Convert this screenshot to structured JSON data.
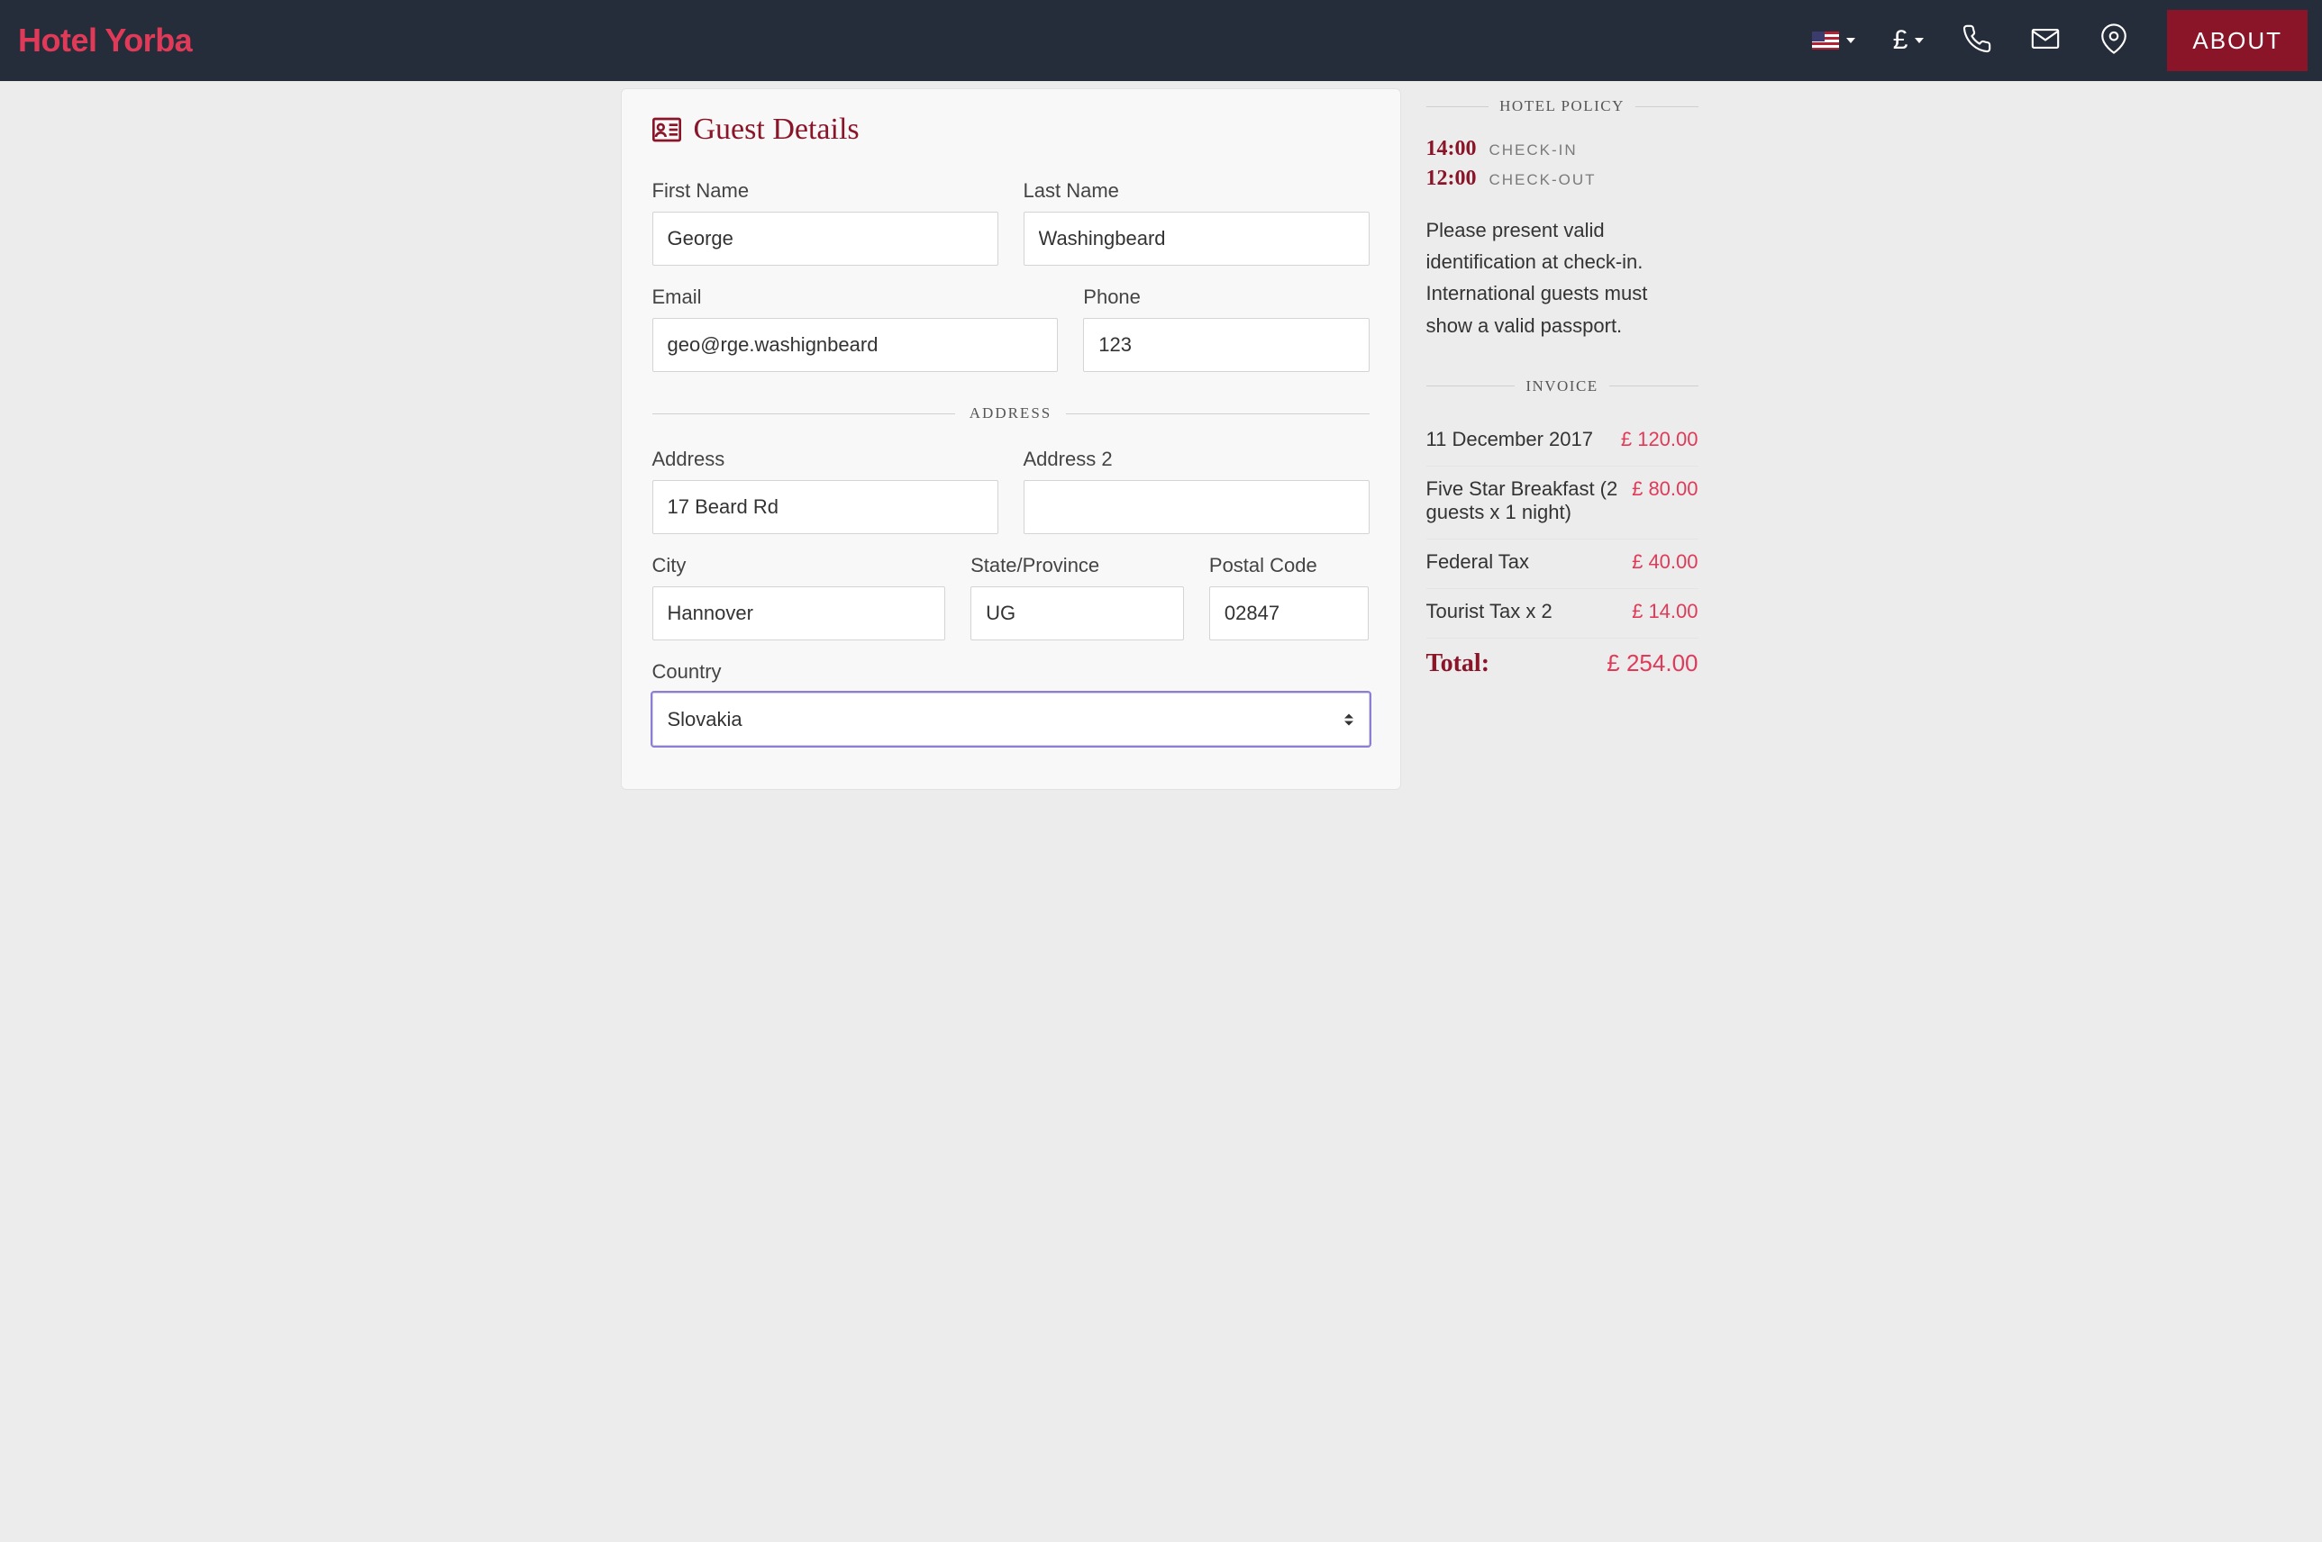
{
  "header": {
    "logo": "Hotel Yorba",
    "currency_symbol": "£",
    "about_label": "ABOUT"
  },
  "form": {
    "section_title": "Guest Details",
    "labels": {
      "first_name": "First Name",
      "last_name": "Last Name",
      "email": "Email",
      "phone": "Phone",
      "address_divider": "ADDRESS",
      "address": "Address",
      "address2": "Address 2",
      "city": "City",
      "state": "State/Province",
      "postal": "Postal Code",
      "country": "Country"
    },
    "values": {
      "first_name": "George",
      "last_name": "Washingbeard",
      "email": "geo@rge.washignbeard",
      "phone": "123",
      "address": "17 Beard Rd",
      "address2": "",
      "city": "Hannover",
      "state": "UG",
      "postal": "02847",
      "country": "Slovakia"
    }
  },
  "sidebar": {
    "policy": {
      "title": "HOTEL POLICY",
      "check_in_time": "14:00",
      "check_in_label": "CHECK-IN",
      "check_out_time": "12:00",
      "check_out_label": "CHECK-OUT",
      "text": "Please present valid identification at check-in. International guests must show a valid passport."
    },
    "invoice": {
      "title": "INVOICE",
      "items": [
        {
          "label": "11 December 2017",
          "value": "£ 120.00"
        },
        {
          "label": "Five Star Breakfast (2 guests x 1 night)",
          "value": "£ 80.00"
        },
        {
          "label": "Federal Tax",
          "value": "£ 40.00"
        },
        {
          "label": "Tourist Tax x 2",
          "value": "£ 14.00"
        }
      ],
      "total_label": "Total:",
      "total_value": "£ 254.00"
    }
  }
}
